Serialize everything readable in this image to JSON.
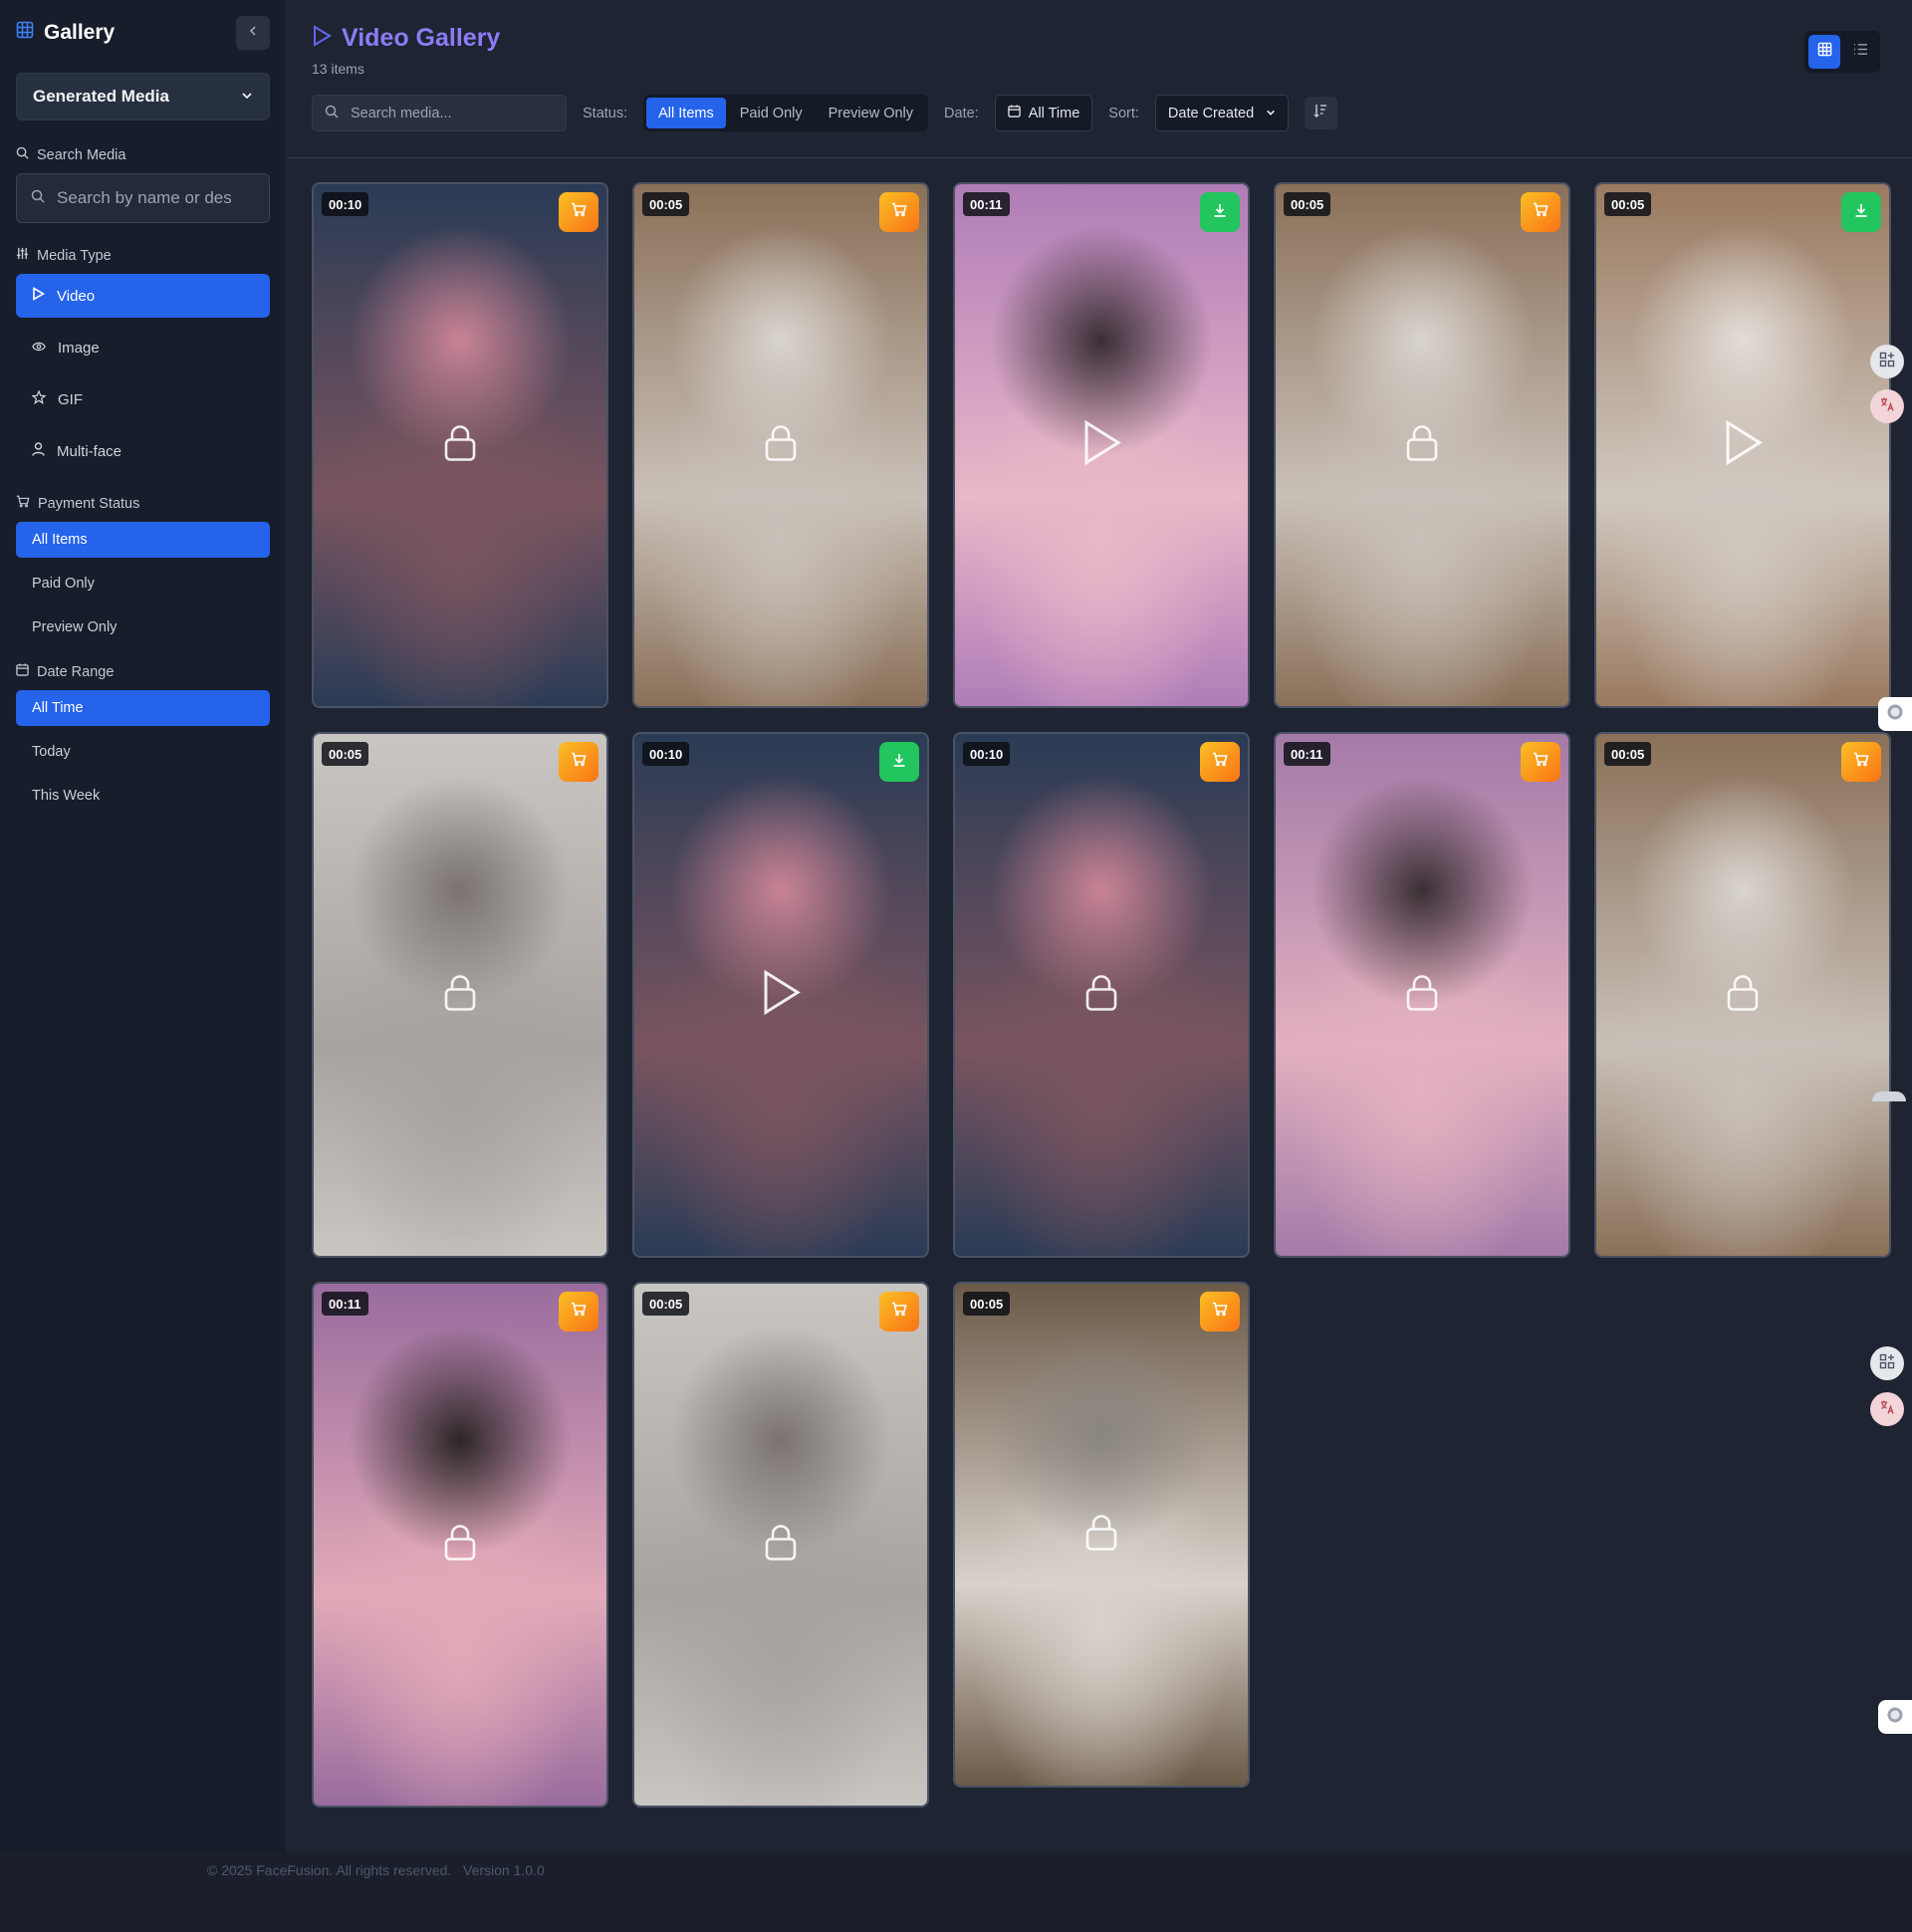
{
  "sidebar": {
    "brand": "Gallery",
    "source_select": "Generated Media",
    "search_section": "Search Media",
    "search_placeholder": "Search by name or des",
    "media_type_section": "Media Type",
    "media_types": [
      {
        "label": "Video",
        "icon": "play-icon",
        "active": true
      },
      {
        "label": "Image",
        "icon": "eye-icon",
        "active": false
      },
      {
        "label": "GIF",
        "icon": "star-icon",
        "active": false
      },
      {
        "label": "Multi-face",
        "icon": "user-icon",
        "active": false
      }
    ],
    "payment_section": "Payment Status",
    "payment_items": [
      {
        "label": "All Items",
        "active": true
      },
      {
        "label": "Paid Only",
        "active": false
      },
      {
        "label": "Preview Only",
        "active": false
      }
    ],
    "date_section": "Date Range",
    "date_items": [
      {
        "label": "All Time",
        "active": true
      },
      {
        "label": "Today",
        "active": false
      },
      {
        "label": "This Week",
        "active": false
      }
    ]
  },
  "header": {
    "title": "Video Gallery",
    "count": "13 items",
    "search_placeholder": "Search media...",
    "status_label": "Status:",
    "status_options": [
      "All Items",
      "Paid Only",
      "Preview Only"
    ],
    "status_active": "All Items",
    "date_label": "Date:",
    "date_value": "All Time",
    "sort_label": "Sort:",
    "sort_value": "Date Created",
    "view_mode": "grid"
  },
  "items": [
    {
      "duration": "00:10",
      "action": "cart",
      "overlay": "lock-icon",
      "palette": [
        "#2a3b55",
        "#7a5560",
        "#c98496"
      ]
    },
    {
      "duration": "00:05",
      "action": "cart",
      "overlay": "lock-icon",
      "palette": [
        "#8a7058",
        "#c8c0b8",
        "#d9d4cf"
      ]
    },
    {
      "duration": "00:11",
      "action": "download",
      "overlay": "play-icon",
      "palette": [
        "#b07cb8",
        "#e8b8c8",
        "#3a2f35"
      ]
    },
    {
      "duration": "00:05",
      "action": "cart",
      "overlay": "lock-icon",
      "palette": [
        "#8a7058",
        "#c8c0b8",
        "#d9d4cf"
      ]
    },
    {
      "duration": "00:05",
      "action": "download",
      "overlay": "play-icon",
      "palette": [
        "#9a7a60",
        "#d0c8c0",
        "#e2ddd8"
      ]
    },
    {
      "duration": "00:05",
      "action": "cart",
      "overlay": "lock-icon",
      "palette": [
        "#c9c6c2",
        "#a8a3a0",
        "#7a7370"
      ]
    },
    {
      "duration": "00:10",
      "action": "download",
      "overlay": "play-icon",
      "palette": [
        "#2a3b55",
        "#7a5560",
        "#c98496"
      ]
    },
    {
      "duration": "00:10",
      "action": "cart",
      "overlay": "lock-icon",
      "palette": [
        "#2a3b55",
        "#7a5560",
        "#c98496"
      ]
    },
    {
      "duration": "00:11",
      "action": "cart",
      "overlay": "lock-icon",
      "palette": [
        "#a47aa8",
        "#e2b0bf",
        "#3a3035"
      ]
    },
    {
      "duration": "00:05",
      "action": "cart",
      "overlay": "lock-icon",
      "palette": [
        "#8a7058",
        "#c8c0b8",
        "#d9d4cf"
      ]
    },
    {
      "duration": "00:11",
      "action": "cart",
      "overlay": "lock-icon",
      "palette": [
        "#9a6c9e",
        "#e2aab8",
        "#2c2628"
      ]
    },
    {
      "duration": "00:05",
      "action": "cart",
      "overlay": "lock-icon",
      "palette": [
        "#c9c6c2",
        "#a8a3a0",
        "#7a7370"
      ]
    },
    {
      "duration": "00:05",
      "action": "cart",
      "overlay": "lock-icon",
      "palette": [
        "#6b5a48",
        "#d8d2cb",
        "#8a8580"
      ]
    }
  ],
  "footer": {
    "copyright": "© 2025 FaceFusion. All rights reserved.",
    "version": "Version 1.0.0"
  },
  "colors": {
    "accent": "#2563eb",
    "title": "#8b7cf6",
    "cart": "#f59e0b",
    "download": "#22c55e"
  }
}
